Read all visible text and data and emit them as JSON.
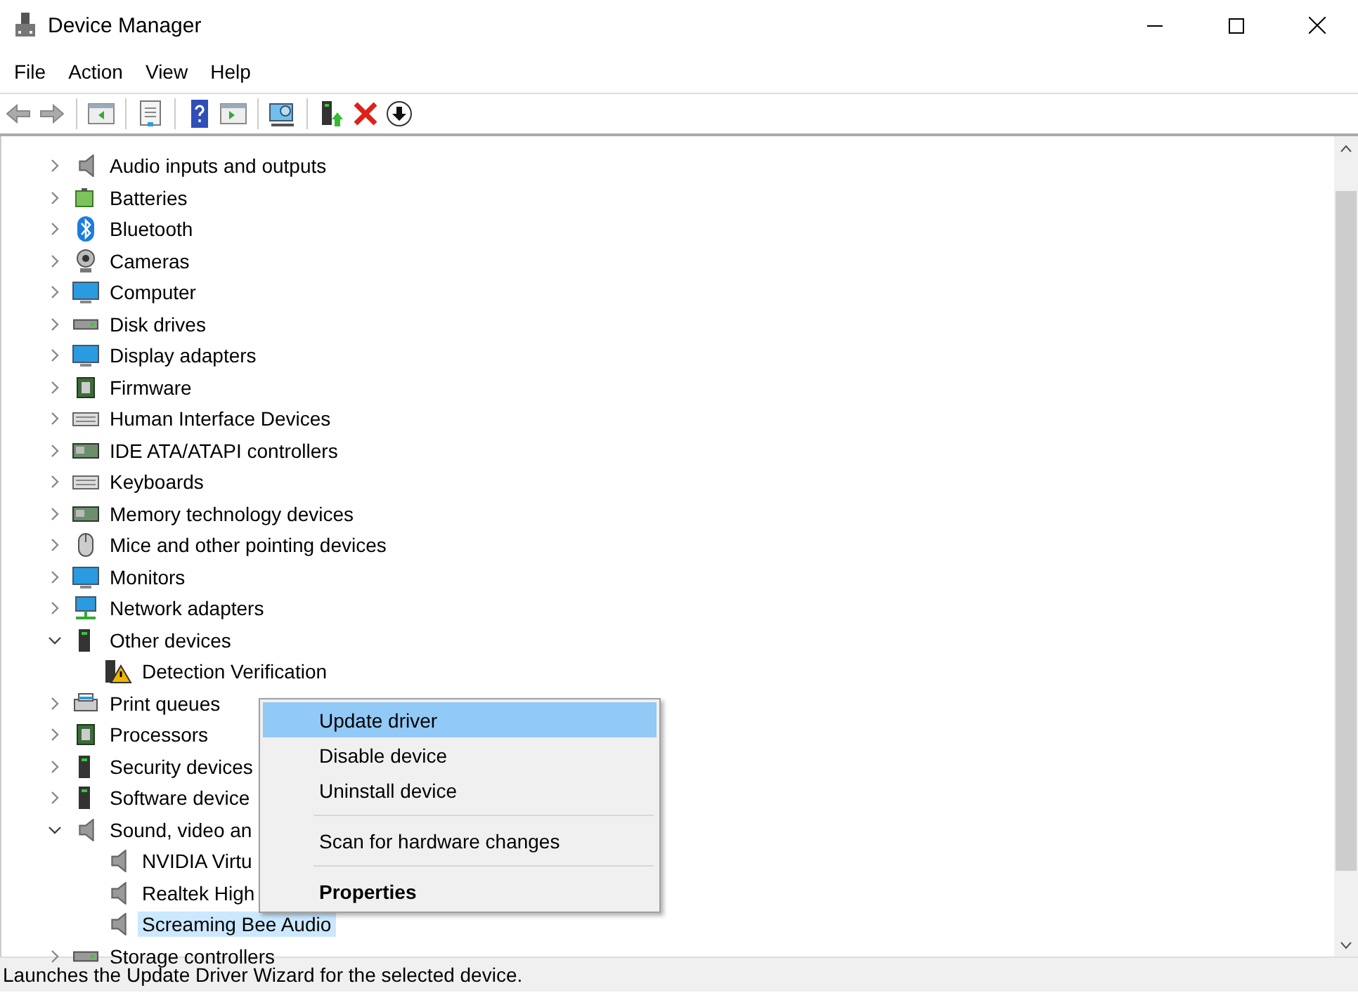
{
  "window": {
    "title": "Device Manager"
  },
  "menu": [
    "File",
    "Action",
    "View",
    "Help"
  ],
  "tree": [
    {
      "label": "Audio inputs and outputs",
      "expanded": false,
      "selected": false
    },
    {
      "label": "Batteries",
      "expanded": false,
      "selected": false
    },
    {
      "label": "Bluetooth",
      "expanded": false,
      "selected": false
    },
    {
      "label": "Cameras",
      "expanded": false,
      "selected": false
    },
    {
      "label": "Computer",
      "expanded": false,
      "selected": false
    },
    {
      "label": "Disk drives",
      "expanded": false,
      "selected": false
    },
    {
      "label": "Display adapters",
      "expanded": false,
      "selected": false
    },
    {
      "label": "Firmware",
      "expanded": false,
      "selected": false
    },
    {
      "label": "Human Interface Devices",
      "expanded": false,
      "selected": false
    },
    {
      "label": "IDE ATA/ATAPI controllers",
      "expanded": false,
      "selected": false
    },
    {
      "label": "Keyboards",
      "expanded": false,
      "selected": false
    },
    {
      "label": "Memory technology devices",
      "expanded": false,
      "selected": false
    },
    {
      "label": "Mice and other pointing devices",
      "expanded": false,
      "selected": false
    },
    {
      "label": "Monitors",
      "expanded": false,
      "selected": false
    },
    {
      "label": "Network adapters",
      "expanded": false,
      "selected": false
    },
    {
      "label": "Other devices",
      "expanded": true,
      "selected": false,
      "children": [
        {
          "label": "Detection Verification",
          "selected": false
        }
      ]
    },
    {
      "label": "Print queues",
      "expanded": false,
      "selected": false
    },
    {
      "label": "Processors",
      "expanded": false,
      "selected": false
    },
    {
      "label": "Security devices",
      "expanded": false,
      "selected": false
    },
    {
      "label": "Software device",
      "expanded": false,
      "selected": false
    },
    {
      "label": "Sound, video an",
      "expanded": true,
      "selected": false,
      "children": [
        {
          "label": "NVIDIA Virtu",
          "selected": false
        },
        {
          "label": "Realtek High",
          "selected": false
        },
        {
          "label": "Screaming Bee Audio",
          "selected": true
        }
      ]
    },
    {
      "label": "Storage controllers",
      "expanded": false,
      "selected": false
    }
  ],
  "context_menu": [
    {
      "label": "Update driver",
      "selected": true,
      "divider_before": false,
      "default": false
    },
    {
      "label": "Disable device",
      "selected": false,
      "divider_before": false,
      "default": false
    },
    {
      "label": "Uninstall device",
      "selected": false,
      "divider_before": false,
      "default": false
    },
    {
      "label": "Scan for hardware changes",
      "selected": false,
      "divider_before": true,
      "default": false
    },
    {
      "label": "Properties",
      "selected": false,
      "divider_before": true,
      "default": true
    }
  ],
  "status_bar": "Launches the Update Driver Wizard for the selected device."
}
